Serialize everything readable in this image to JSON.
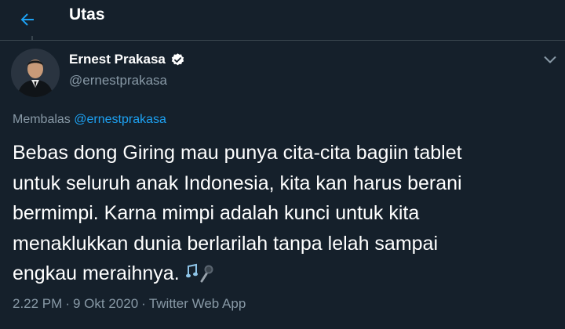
{
  "header": {
    "back_icon": "arrow-left-icon",
    "title": "Utas"
  },
  "colors": {
    "background": "#15202b",
    "accent": "#1da1f2",
    "secondary_text": "#8899a6",
    "border": "#38444d"
  },
  "tweet": {
    "author": {
      "display_name": "Ernest Prakasa",
      "handle": "@ernestprakasa",
      "verified_icon": "verified-badge-icon"
    },
    "reply": {
      "prefix": "Membalas",
      "mention": "@ernestprakasa"
    },
    "text_lines": [
      "Bebas dong Giring mau punya cita-cita bagiin tablet",
      "untuk seluruh anak Indonesia, kita kan harus berani",
      "bermimpi. Karna mimpi adalah kunci untuk kita",
      "menaklukkan dunia berlarilah tanpa lelah sampai",
      "engkau meraihnya."
    ],
    "emoji": "🎶🎤",
    "time": "2.22 PM",
    "separator": "·",
    "date": "9 Okt 2020",
    "source": "Twitter Web App",
    "menu_icon": "chevron-down-icon"
  }
}
